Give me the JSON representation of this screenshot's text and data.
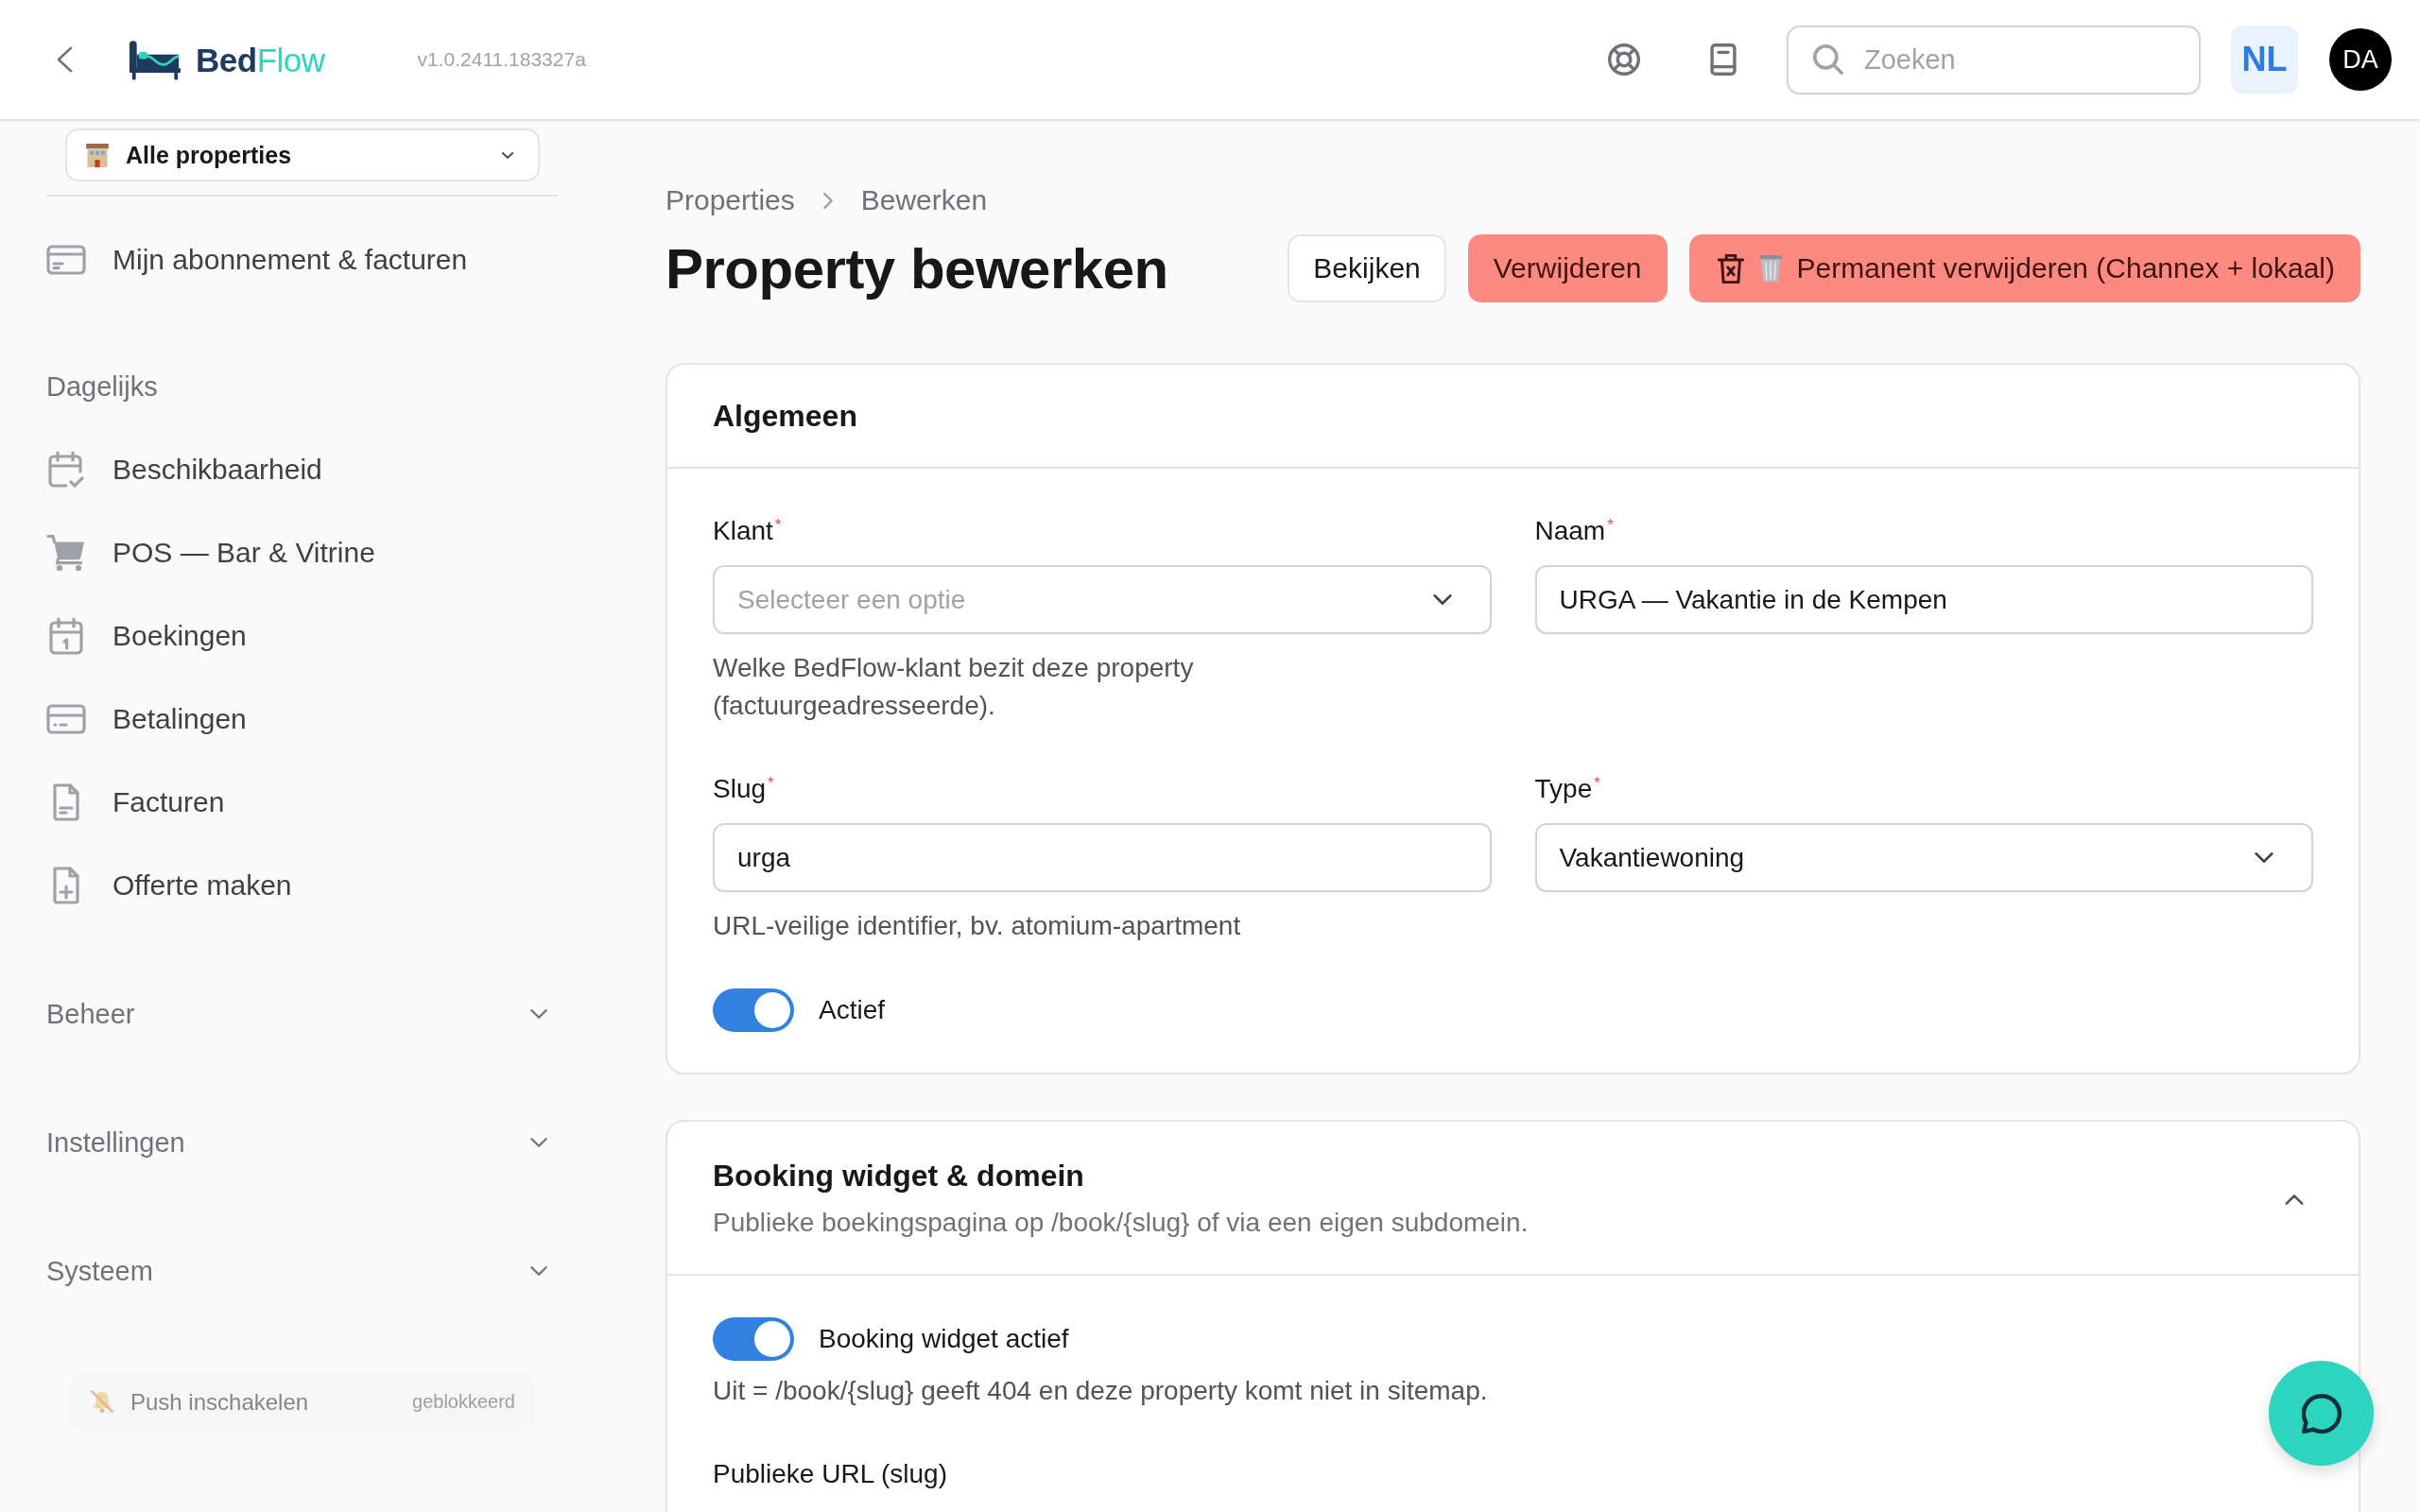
{
  "topbar": {
    "logo": {
      "primary": "Bed",
      "accent": "Flow"
    },
    "version": "v1.0.2411.183327a",
    "search": {
      "placeholder": "Zoeken"
    },
    "language": "NL",
    "avatar": "DA"
  },
  "sidebar": {
    "property_select": {
      "value": "Alle properties"
    },
    "account_items": [
      {
        "label": "Mijn abonnement & facturen",
        "selected": false
      }
    ],
    "sections": [
      {
        "kind": "group",
        "title": "Dagelijks",
        "items": [
          {
            "label": "Beschikbaarheid",
            "selected": false
          },
          {
            "label": "POS — Bar & Vitrine",
            "selected": false
          },
          {
            "label": "Boekingen",
            "selected": false
          },
          {
            "label": "Betalingen",
            "selected": false
          },
          {
            "label": "Facturen",
            "selected": false
          },
          {
            "label": "Offerte maken",
            "selected": false
          }
        ]
      },
      {
        "kind": "collapsible",
        "title": "Beheer",
        "expanded": false
      },
      {
        "kind": "collapsible",
        "title": "Instellingen",
        "expanded": false
      },
      {
        "kind": "collapsible",
        "title": "Systeem",
        "expanded": false
      }
    ],
    "push": {
      "label": "Push inschakelen",
      "status": "geblokkeerd",
      "disabled": true
    }
  },
  "breadcrumb": [
    "Properties",
    "Bewerken"
  ],
  "page_title": "Property bewerken",
  "actions": [
    {
      "kind": "secondary",
      "label": "Bekijken"
    },
    {
      "kind": "danger",
      "label": "Verwijderen"
    },
    {
      "kind": "danger_permanent",
      "label": "Permanent verwijderen (Channex + lokaal)"
    }
  ],
  "general": {
    "title": "Algemeen",
    "fields": [
      {
        "kind": "select",
        "label": "Klant$^{*}$",
        "placeholder": "Selecteer een optie",
        "help": "Welke BedFlow-klant bezit deze property (factuurgeadresseerde)."
      },
      {
        "kind": "text",
        "label": "Naam$^{*}$",
        "value": "URGA — Vakantie in de Kempen"
      },
      {
        "kind": "text",
        "label": "Slug$^{*}$",
        "value": "urga",
        "help": "URL-veilige identifier, bv. atomium-apartment"
      },
      {
        "kind": "select",
        "label": "Type$^{*}$",
        "value": "Vakantiewoning"
      }
    ],
    "toggle": {
      "label": "Actief",
      "on": true
    }
  },
  "booking_widget": {
    "title": "Booking widget & domein",
    "description": "Publieke boekingspagina op /book/{slug} of via een eigen subdomein.",
    "expanded": true,
    "toggle": {
      "label": "Booking widget actief",
      "on": true,
      "help": "Uit = /book/{slug} geeft 404 en deze property komt niet in sitemap."
    },
    "field_label": "Publieke URL (slug)"
  }
}
